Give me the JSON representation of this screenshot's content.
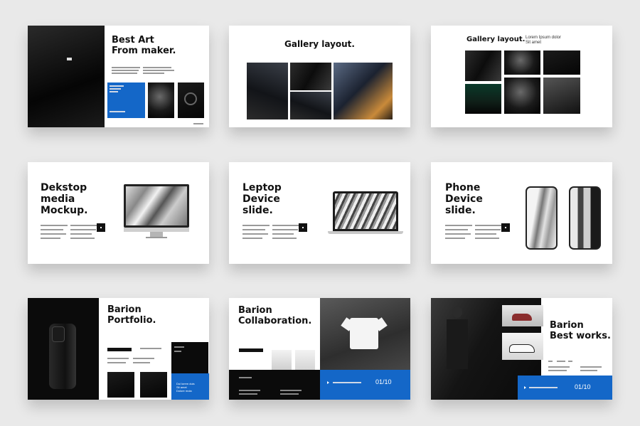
{
  "slides": {
    "s1": {
      "title_1": "Best Art",
      "title_2": "From maker."
    },
    "s2": {
      "title": "Gallery layout."
    },
    "s3": {
      "title": "Gallery layout.",
      "subtitle_1": "Lorem Ipsum dolor",
      "subtitle_2": "Sit amet"
    },
    "s4": {
      "title_1": "Dekstop",
      "title_2": "media",
      "title_3": "Mockup."
    },
    "s5": {
      "title_1": "Leptop",
      "title_2": "Device",
      "title_3": "slide."
    },
    "s6": {
      "title_1": "Phone",
      "title_2": "Device",
      "title_3": "slide."
    },
    "s7": {
      "title_1": "Barion",
      "title_2": "Portfolio.",
      "footer_1": "Dui lorem duis",
      "footer_2": "Sit amet",
      "footer_3": "Dolore mola"
    },
    "s8": {
      "title_1": "Barion",
      "title_2": "Collaboration.",
      "page": "01/10"
    },
    "s9": {
      "title_1": "Barion",
      "title_2": "Best works.",
      "page": "01/10"
    }
  },
  "colors": {
    "accent": "#1467c8",
    "dark": "#0b0b0b",
    "page_bg": "#e9e9e9"
  }
}
